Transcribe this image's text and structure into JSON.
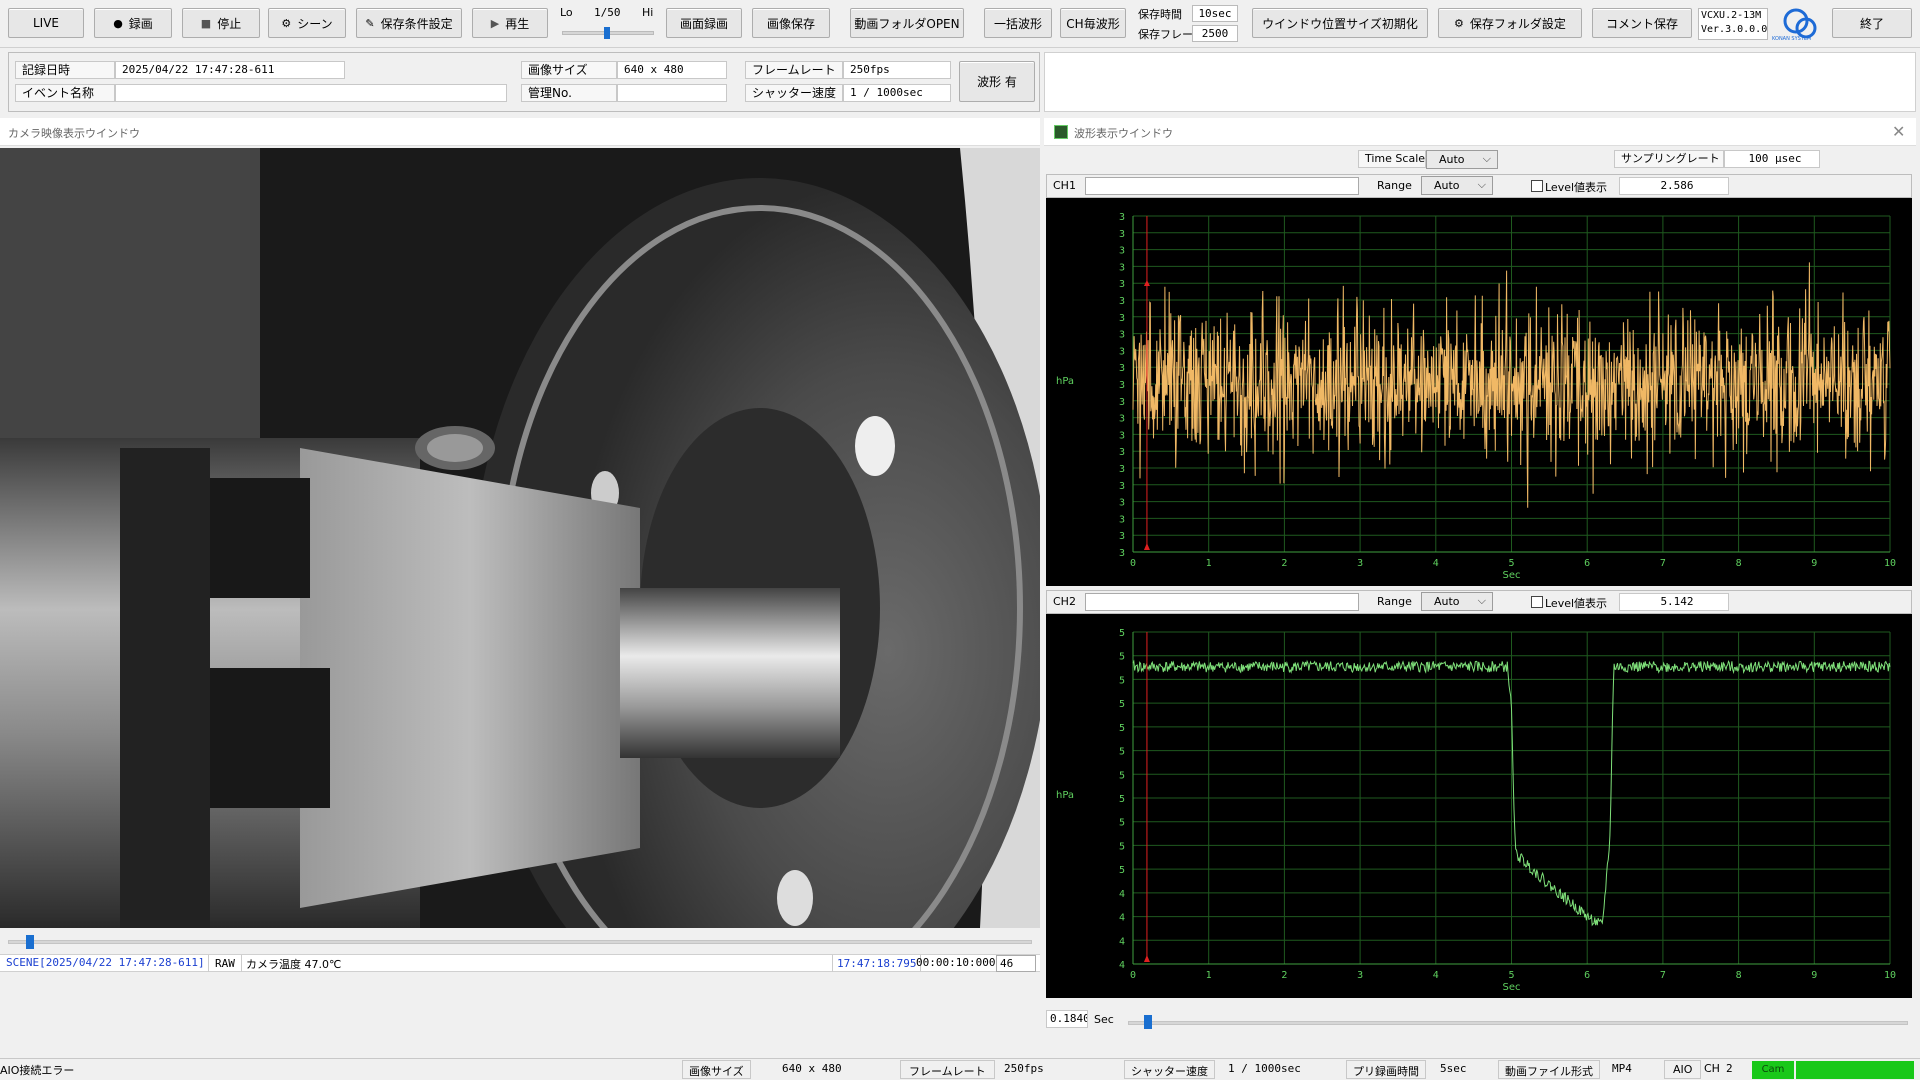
{
  "toolbar": {
    "live": "LIVE",
    "record": "録画",
    "stop": "停止",
    "scene": "シーン",
    "save_condition": "保存条件設定",
    "play": "再生",
    "speed_lo": "Lo",
    "speed_value": "1/50",
    "speed_hi": "Hi",
    "screen_record": "画面録画",
    "image_save": "画像保存",
    "video_folder_open": "動画フォルダOPEN",
    "batch_waveform": "一括波形",
    "ch_waveform": "CH毎波形",
    "save_time_label": "保存時間",
    "save_time_value": "10sec",
    "save_frame_label": "保存フレーム",
    "save_frame_value": "2500",
    "window_reset": "ウインドウ位置サイズ初期化",
    "save_folder_setting": "保存フォルダ設定",
    "comment_save": "コメント保存",
    "model": "VCXU.2-13M",
    "version": "Ver.3.0.0.0",
    "exit": "終了",
    "logo_text": "KONAN SYSTEM"
  },
  "info": {
    "rec_datetime_label": "記録日時",
    "rec_datetime_value": "2025/04/22  17:47:28-611",
    "event_name_label": "イベント名称",
    "event_name_value": "",
    "image_size_label": "画像サイズ",
    "image_size_value": "640 x 480",
    "control_no_label": "管理No.",
    "control_no_value": "",
    "frame_rate_label": "フレームレート",
    "frame_rate_value": "250fps",
    "shutter_label": "シャッター速度",
    "shutter_value": "1 / 1000sec",
    "waveform_presence": "波形 有"
  },
  "camera_window": {
    "title": "カメラ映像表示ウインドウ",
    "scene_text": "SCENE[2025/04/22 17:47:28-611]",
    "raw": "RAW",
    "camera_temp": "カメラ温度 47.0℃",
    "time_readout": "17:47:18:795",
    "elapsed": "00:00:10:000",
    "frame_no": "46",
    "slider_position": 0.02
  },
  "waveform_window": {
    "title": "波形表示ウインドウ",
    "time_scale_label": "Time Scale",
    "time_scale_value": "Auto",
    "sampling_rate_label": "サンプリングレート",
    "sampling_rate_value": "100 μsec",
    "ch1": {
      "name": "CH1",
      "input_value": "",
      "range_label": "Range",
      "range_value": "Auto",
      "level_checkbox_label": "Level値表示",
      "level_value": "2.586"
    },
    "ch2": {
      "name": "CH2",
      "input_value": "",
      "range_label": "Range",
      "range_value": "Auto",
      "level_checkbox_label": "Level値表示",
      "level_value": "5.142"
    },
    "cursor_time": "0.1840",
    "cursor_unit": "Sec",
    "slider_position": 0.02
  },
  "status_bar": {
    "aio_error": "AIO接続エラー",
    "image_size_label": "画像サイズ",
    "image_size_value": "640 x 480",
    "frame_rate_label": "フレームレート",
    "frame_rate_value": "250fps",
    "shutter_label": "シャッター速度",
    "shutter_value": "1 / 1000sec",
    "pre_record_label": "プリ録画時間",
    "pre_record_value": "5sec",
    "file_format_label": "動画ファイル形式",
    "file_format_value": "MP4",
    "aio": "AIO",
    "ch": "CH",
    "ch_value": "2",
    "cam": "Cam"
  },
  "chart_data": [
    {
      "type": "line",
      "title": "",
      "xlabel": "Sec",
      "ylabel": "hPa",
      "xlim": [
        0,
        10
      ],
      "x_ticks": [
        "0",
        "1",
        "2",
        "3",
        "4",
        "5",
        "6",
        "7",
        "8",
        "9",
        "10"
      ],
      "y_ticks": [
        "3",
        "3",
        "3",
        "3",
        "3",
        "3",
        "3",
        "3",
        "3",
        "3",
        "3",
        "3",
        "3",
        "3",
        "3",
        "3",
        "3",
        "3",
        "3",
        "3",
        "3"
      ],
      "series_color": "#f0b865",
      "cursor_x": 0.184,
      "description_of_shape": "noise",
      "series": [
        {
          "baseline": 3.0,
          "noise_amplitude": 0.35
        }
      ],
      "grid": true
    },
    {
      "type": "line",
      "title": "",
      "xlabel": "Sec",
      "ylabel": "hPa",
      "xlim": [
        0,
        10
      ],
      "x_ticks": [
        "0",
        "1",
        "2",
        "3",
        "4",
        "5",
        "6",
        "7",
        "8",
        "9",
        "10"
      ],
      "y_ticks": [
        "5",
        "5",
        "5",
        "5",
        "5",
        "5",
        "5",
        "5",
        "5",
        "5",
        "5",
        "4",
        "4",
        "4",
        "4"
      ],
      "series_color": "#7fe07a",
      "cursor_x": 0.184,
      "series": [
        {
          "x": [
            0,
            4.95,
            5.0,
            5.05,
            5.5,
            6.0,
            6.2,
            6.3,
            6.35,
            10
          ],
          "y": [
            5.14,
            5.14,
            5.0,
            4.55,
            4.45,
            4.35,
            4.32,
            4.6,
            5.14,
            5.14
          ]
        }
      ],
      "grid": true
    }
  ]
}
